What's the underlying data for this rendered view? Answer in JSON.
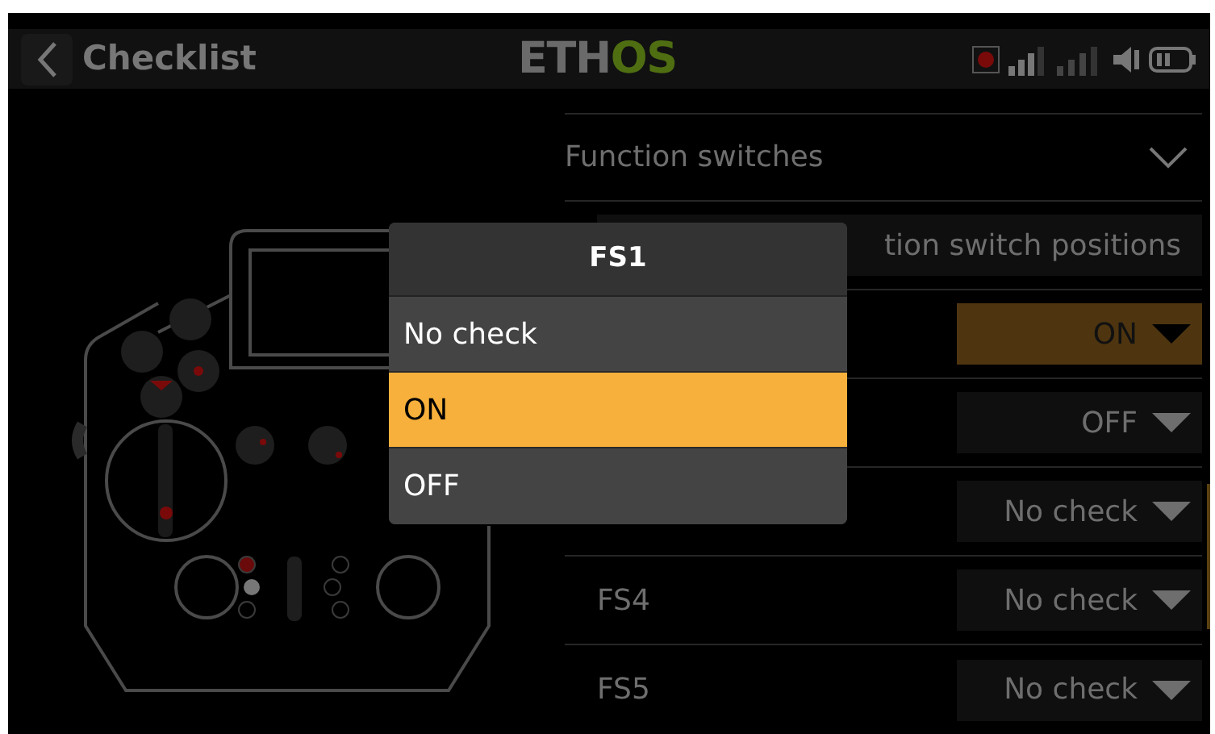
{
  "header": {
    "title": "Checklist",
    "logo": [
      {
        "text": "ETH",
        "kind": "plain"
      },
      {
        "text": "OS",
        "kind": "accent"
      }
    ]
  },
  "section": {
    "title": "Function switches",
    "expanded": true,
    "button": "tion switch positions"
  },
  "rows": [
    {
      "label": "",
      "value": "ON",
      "selected": true
    },
    {
      "label": "",
      "value": "OFF",
      "selected": false
    },
    {
      "label": "",
      "value": "No check",
      "selected": false
    },
    {
      "label": "FS4",
      "value": "No check",
      "selected": false
    },
    {
      "label": "FS5",
      "value": "No check",
      "selected": false
    }
  ],
  "popup": {
    "title": "FS1",
    "options": [
      {
        "label": "No check",
        "selected": false
      },
      {
        "label": "ON",
        "selected": true
      },
      {
        "label": "OFF",
        "selected": false
      }
    ]
  }
}
